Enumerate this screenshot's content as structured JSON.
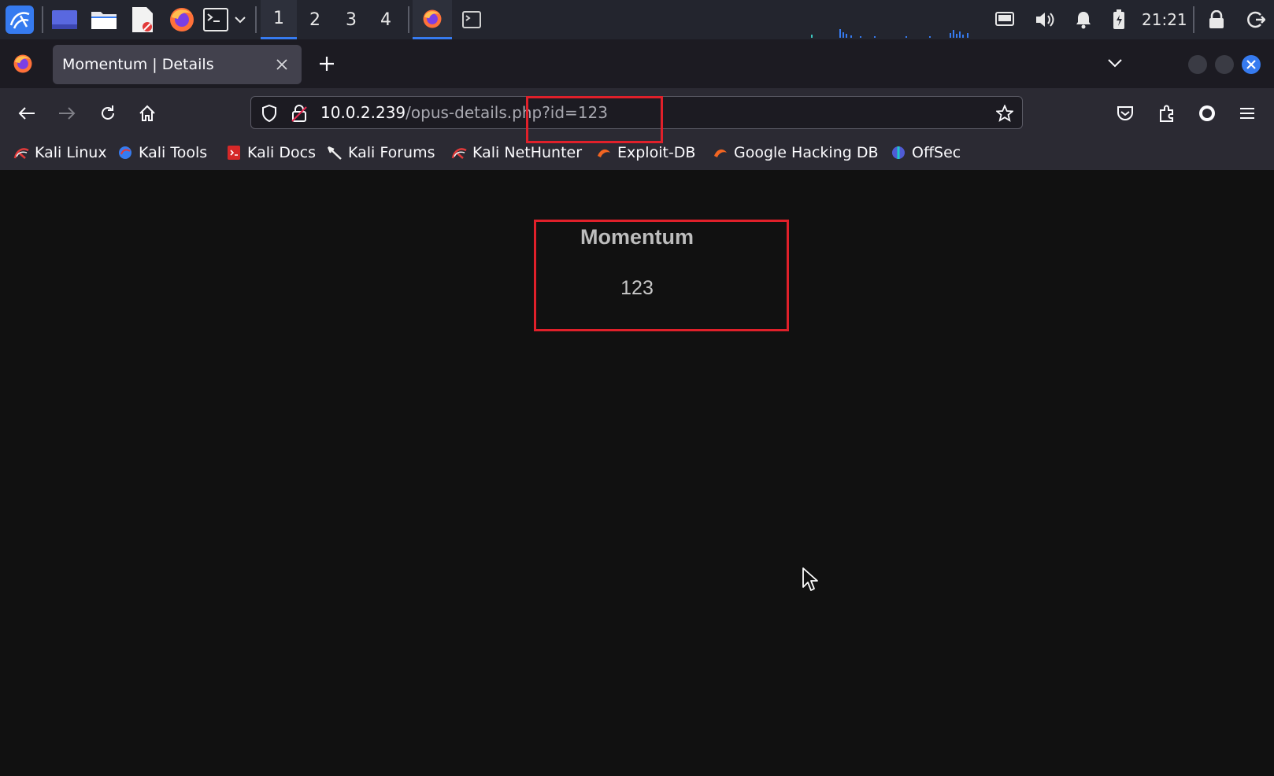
{
  "taskbar": {
    "workspaces": [
      "1",
      "2",
      "3",
      "4"
    ],
    "active_workspace": "1",
    "clock": "21:21",
    "accent_color": "#367bf0"
  },
  "browser": {
    "tab_title": "Momentum | Details",
    "url_host": "10.0.2.239",
    "url_path": "/opus-details.php?id=123",
    "bookmarks": [
      {
        "label": "Kali Linux",
        "icon": "kali-dragon-icon"
      },
      {
        "label": "Kali Tools",
        "icon": "kali-tools-icon"
      },
      {
        "label": "Kali Docs",
        "icon": "kali-docs-icon"
      },
      {
        "label": "Kali Forums",
        "icon": "kali-forums-icon"
      },
      {
        "label": "Kali NetHunter",
        "icon": "kali-nethunter-icon"
      },
      {
        "label": "Exploit-DB",
        "icon": "exploit-db-icon"
      },
      {
        "label": "Google Hacking DB",
        "icon": "google-hacking-db-icon"
      },
      {
        "label": "OffSec",
        "icon": "offsec-icon"
      }
    ]
  },
  "page": {
    "title": "Momentum",
    "value": "123"
  },
  "highlight_color": "#e0202a"
}
